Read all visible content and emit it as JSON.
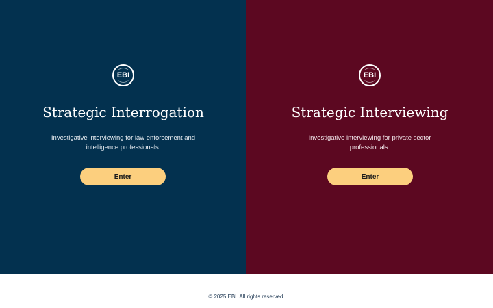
{
  "left_panel": {
    "logo_text": "EBI",
    "title": "Strategic Interrogation",
    "description": "Investigative interviewing for law enforcement and intelligence professionals.",
    "button_label": "Enter",
    "background_color": "#03314f"
  },
  "right_panel": {
    "logo_text": "EBI",
    "title": "Strategic Interviewing",
    "description": "Investigative interviewing for private sector professionals.",
    "button_label": "Enter",
    "background_color": "#5c0821"
  },
  "button_color": "#fccf7e",
  "footer": {
    "copyright": "© 2025 EBI. All rights reserved."
  }
}
